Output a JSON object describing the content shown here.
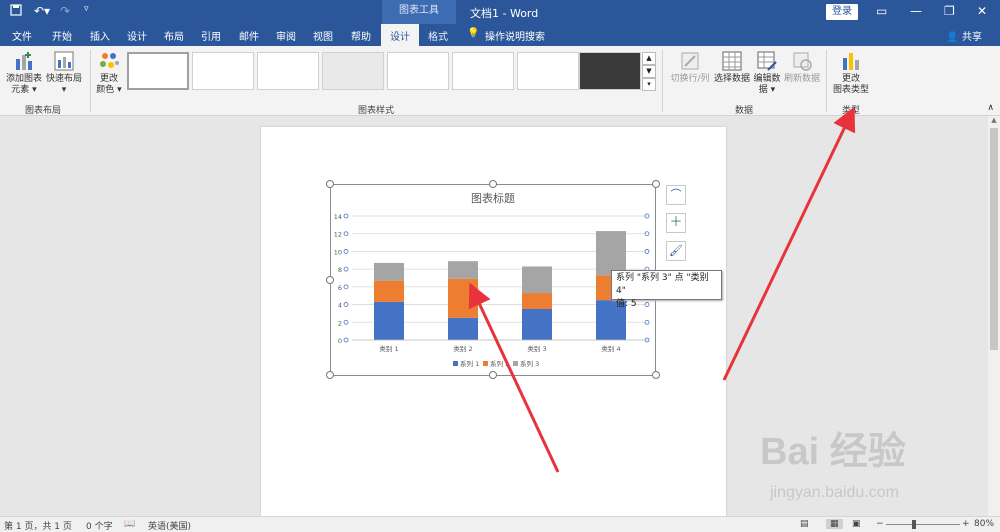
{
  "titlebar": {
    "context_tab": "图表工具",
    "doc_title": "文档1 - Word",
    "login": "登录",
    "save_icon": "save-icon",
    "undo_icon": "undo-icon",
    "redo_icon": "redo-icon"
  },
  "tabs": {
    "file": "文件",
    "home": "开始",
    "insert": "插入",
    "design_main": "设计",
    "layout": "布局",
    "references": "引用",
    "mailings": "邮件",
    "review": "审阅",
    "view": "视图",
    "help": "帮助",
    "chart_design": "设计",
    "format": "格式",
    "tell_me": "操作说明搜索",
    "share": "共享"
  },
  "ribbon": {
    "add_element": "添加图表\n元素",
    "quick_layout": "快速布局",
    "group_layout": "图表布局",
    "change_colors": "更改\n颜色",
    "group_styles": "图表样式",
    "switch_row_col": "切换行/列",
    "select_data": "选择数据",
    "edit_data": "编辑数\n据",
    "refresh_data": "刷新数据",
    "group_data": "数据",
    "change_type": "更改\n图表类型",
    "group_type": "类型"
  },
  "tooltip": {
    "line1": "系列 \"系列 3\" 点 \"类别 4\"",
    "line2": "值: 5"
  },
  "status": {
    "page": "第 1 页，共 1 页",
    "words": "0 个字",
    "lang": "英语(美国)",
    "zoom": "80%"
  },
  "watermark": {
    "main": "Bai 经验",
    "sub": "jingyan.baidu.com"
  },
  "colors": {
    "accent": "#2b579a",
    "series1": "#4472c4",
    "series2": "#ed7d31",
    "series3": "#a5a5a5",
    "arrow": "#e8333a"
  },
  "chart_data": {
    "type": "bar",
    "stacked": true,
    "title": "图表标题",
    "categories": [
      "类别 1",
      "类别 2",
      "类别 3",
      "类别 4"
    ],
    "series": [
      {
        "name": "系列 1",
        "values": [
          4.3,
          2.5,
          3.5,
          4.5
        ]
      },
      {
        "name": "系列 2",
        "values": [
          2.4,
          4.4,
          1.8,
          2.8
        ]
      },
      {
        "name": "系列 3",
        "values": [
          2.0,
          2.0,
          3.0,
          5.0
        ]
      }
    ],
    "ylim": [
      0,
      14
    ],
    "yticks": [
      "0",
      "2",
      "4",
      "6",
      "8",
      "10",
      "12",
      "14"
    ],
    "grid": true,
    "legend": "bottom"
  }
}
